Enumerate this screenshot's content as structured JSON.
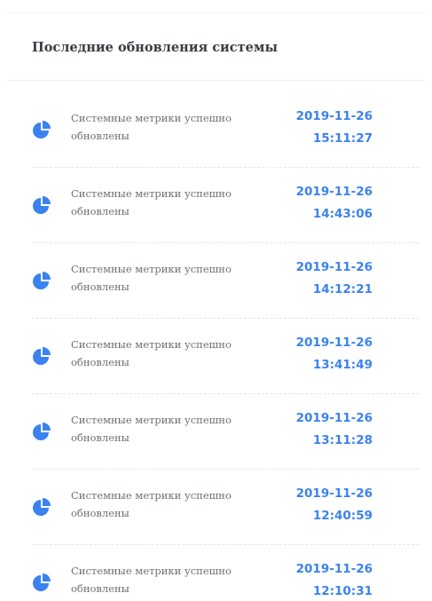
{
  "widget": {
    "title": "Последние обновления системы",
    "accent_color": "#3b82f0"
  },
  "updates": [
    {
      "icon": "pie-chart-icon",
      "message": "Системные метрики успешно обновлены",
      "date": "2019-11-26",
      "time": "15:11:27"
    },
    {
      "icon": "pie-chart-icon",
      "message": "Системные метрики успешно обновлены",
      "date": "2019-11-26",
      "time": "14:43:06"
    },
    {
      "icon": "pie-chart-icon",
      "message": "Системные метрики успешно обновлены",
      "date": "2019-11-26",
      "time": "14:12:21"
    },
    {
      "icon": "pie-chart-icon",
      "message": "Системные метрики успешно обновлены",
      "date": "2019-11-26",
      "time": "13:41:49"
    },
    {
      "icon": "pie-chart-icon",
      "message": "Системные метрики успешно обновлены",
      "date": "2019-11-26",
      "time": "13:11:28"
    },
    {
      "icon": "pie-chart-icon",
      "message": "Системные метрики успешно обновлены",
      "date": "2019-11-26",
      "time": "12:40:59"
    },
    {
      "icon": "pie-chart-icon",
      "message": "Системные метрики успешно обновлены",
      "date": "2019-11-26",
      "time": "12:10:31"
    }
  ]
}
